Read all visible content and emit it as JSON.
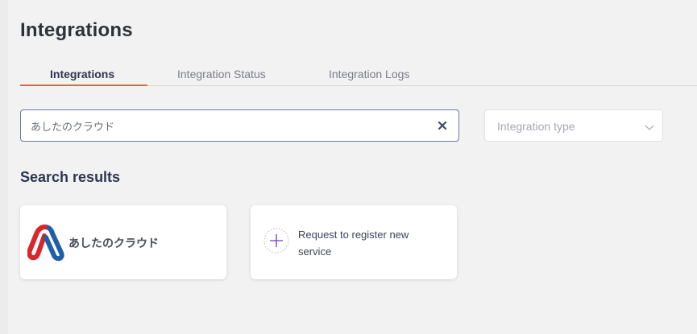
{
  "page": {
    "title": "Integrations"
  },
  "tabs": [
    {
      "label": "Integrations",
      "active": true
    },
    {
      "label": "Integration Status",
      "active": false
    },
    {
      "label": "Integration Logs",
      "active": false
    }
  ],
  "search": {
    "value": "あしたのクラウド",
    "clear_icon": "close-icon"
  },
  "filter": {
    "placeholder": "Integration type",
    "icon": "chevron-down-icon"
  },
  "results": {
    "title": "Search results",
    "items": [
      {
        "name": "あしたのクラウド",
        "logo": "ashita-cloud-logo"
      }
    ],
    "request_card": {
      "label": "Request to register new service",
      "icon": "plus-icon"
    }
  },
  "colors": {
    "accent": "#e2683a",
    "search_border": "#6c7aa8",
    "plus_icon": "#6a3fbf",
    "logo_red": "#d9262b",
    "logo_blue": "#1f5fa8"
  }
}
